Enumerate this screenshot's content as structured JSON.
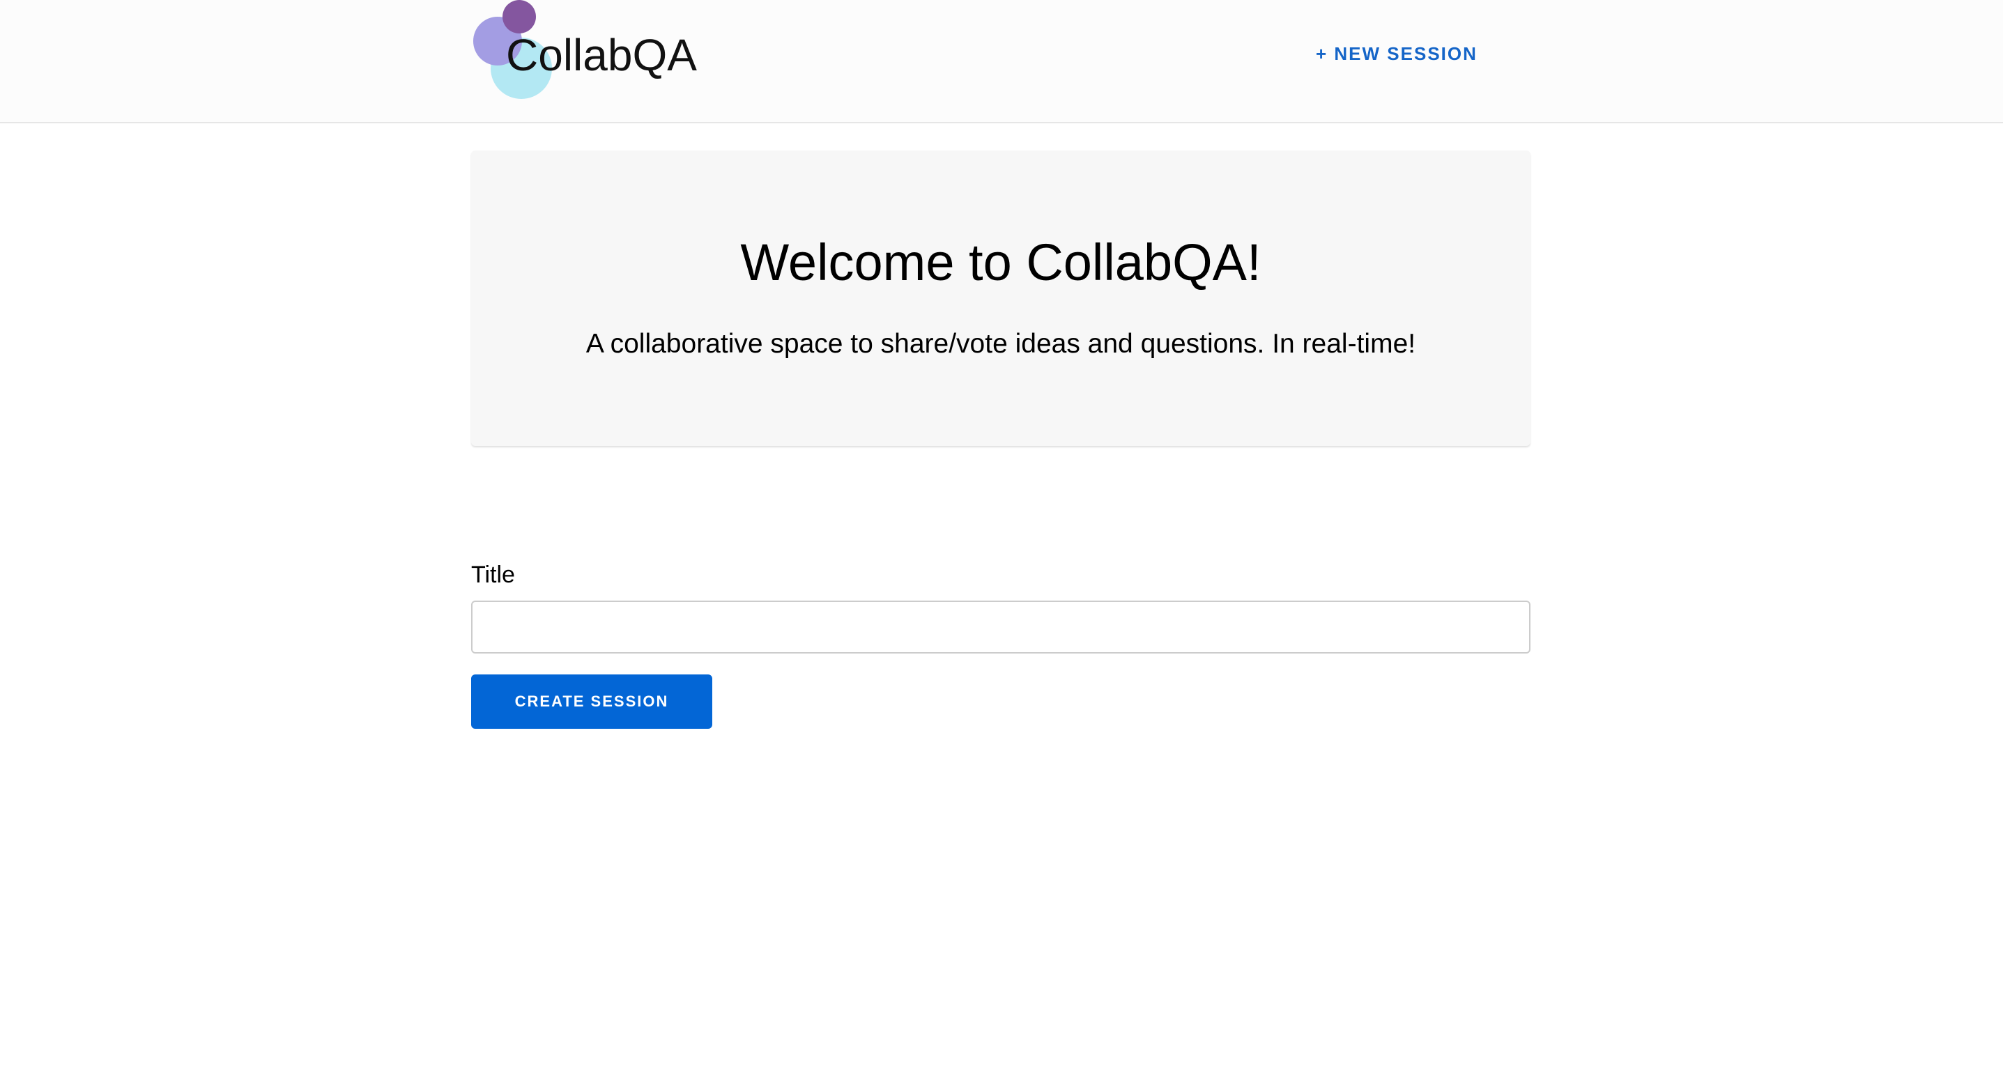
{
  "header": {
    "logo_text": "CollabQA",
    "new_session_link": "+ NEW SESSION"
  },
  "hero": {
    "title": "Welcome to CollabQA!",
    "subtitle": "A collaborative space to share/vote ideas and questions. In real-time!"
  },
  "form": {
    "title_label": "Title",
    "title_value": "",
    "title_placeholder": "",
    "create_button": "CREATE SESSION"
  },
  "colors": {
    "accent": "#0366d6",
    "link": "#1565c8",
    "header_bg": "#fcfcfc",
    "hero_bg": "#f7f7f7",
    "logo_circle_dark": "#84569f",
    "logo_circle_mid": "#a39de3",
    "logo_circle_light": "#b3e8f3"
  }
}
